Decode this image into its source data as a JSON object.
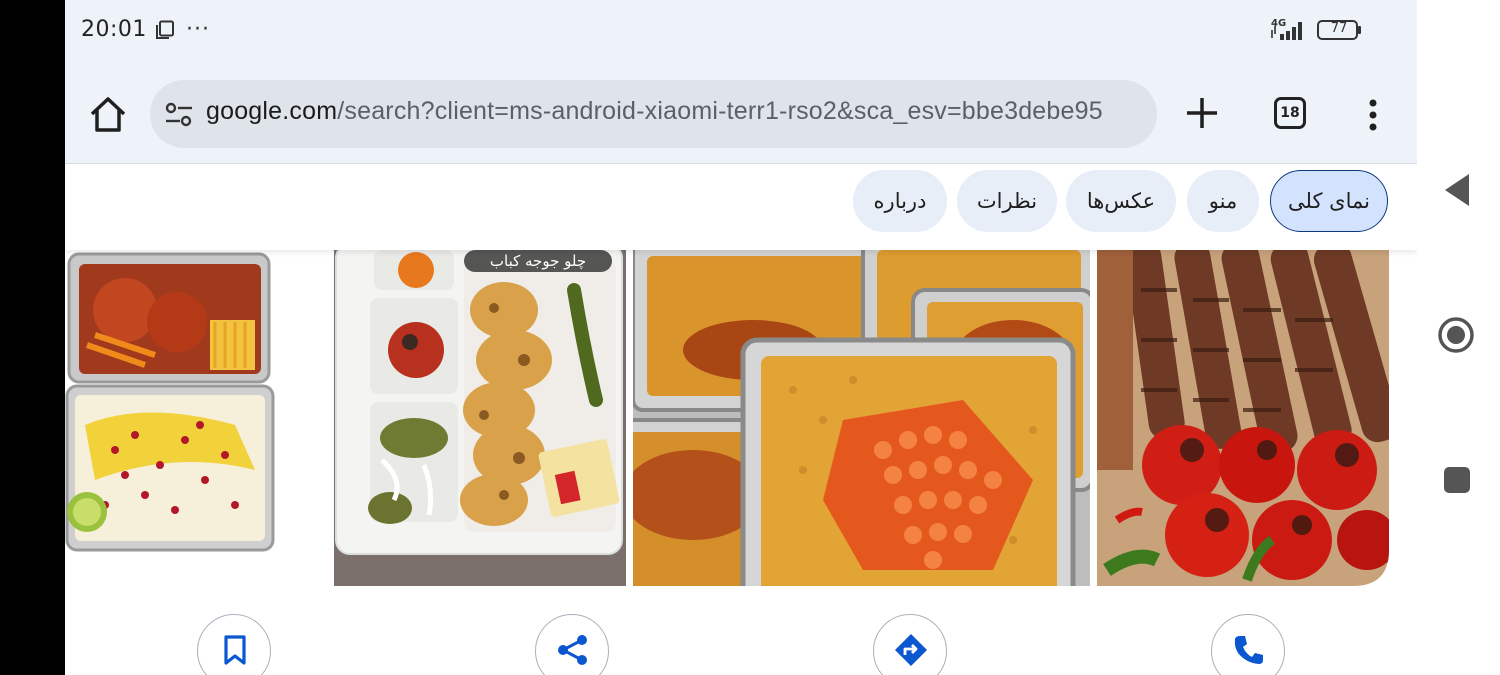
{
  "status_bar": {
    "time": "20:01",
    "more": "···",
    "network": "4G",
    "battery": "77"
  },
  "browser": {
    "url_host": "google.com",
    "url_rest": "/search?client=ms-android-xiaomi-terr1-rso2&sca_esv=bbe3debe95",
    "tab_count": "18"
  },
  "place_tabs": [
    {
      "label": "نمای کلی",
      "active": true
    },
    {
      "label": "منو",
      "active": false
    },
    {
      "label": "عکس‌ها",
      "active": false
    },
    {
      "label": "نظرات",
      "active": false
    },
    {
      "label": "درباره",
      "active": false
    }
  ],
  "photos": {
    "caption": "چلو جوجه کباب"
  },
  "actions": [
    {
      "icon": "bookmark-icon"
    },
    {
      "icon": "share-icon"
    },
    {
      "icon": "directions-icon"
    },
    {
      "icon": "phone-icon"
    }
  ],
  "colors": {
    "accent": "#0b57d0",
    "chip_bg": "#e8eef8",
    "chip_active_bg": "#d3e3fd",
    "toolbar_bg": "#eef2f9"
  }
}
